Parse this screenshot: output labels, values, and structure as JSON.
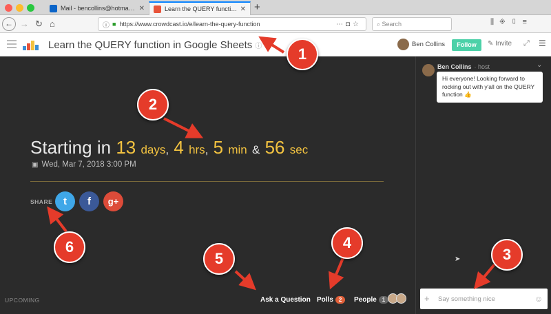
{
  "browser": {
    "tabs": [
      {
        "label": "Mail - bencollins@hotmail.com",
        "favicon": "outlook-icon"
      },
      {
        "label": "Learn the QUERY function in Go",
        "favicon": "crowdcast-icon"
      }
    ],
    "new_tab": "+",
    "url": "https://www.crowdcast.io/e/learn-the-query-function",
    "search_placeholder": "Search"
  },
  "app": {
    "title": "Learn the QUERY function in Google Sheets",
    "host_name": "Ben Collins",
    "follow_label": "Follow",
    "invite_label": "Invite"
  },
  "stage": {
    "starting_label": "Starting in",
    "days": "13",
    "days_unit": "days",
    "hours": "4",
    "hours_unit": "hrs",
    "minutes": "5",
    "minutes_unit": "min",
    "amp": "&",
    "seconds": "56",
    "seconds_unit": "sec",
    "date": "Wed, Mar 7, 2018 3:00 PM",
    "share_label": "SHARE",
    "status_label": "UPCOMING",
    "ask_question_label": "Ask a Question",
    "polls_label": "Polls",
    "polls_count": "2",
    "people_label": "People",
    "people_count": "1"
  },
  "chat": {
    "author": "Ben Collins",
    "author_role": "· host",
    "message": "Hi everyone! Looking forward to rocking out with y'all on the QUERY function 👍",
    "input_placeholder": "Say something nice"
  },
  "annotations": [
    "1",
    "2",
    "3",
    "4",
    "5",
    "6"
  ],
  "colors": {
    "accent_yellow": "#f2c240",
    "follow_green": "#4cd1a8",
    "callout_red": "#e53b2a",
    "twitter": "#3fa7e8",
    "facebook": "#3b5998",
    "googleplus": "#dd4b39"
  }
}
